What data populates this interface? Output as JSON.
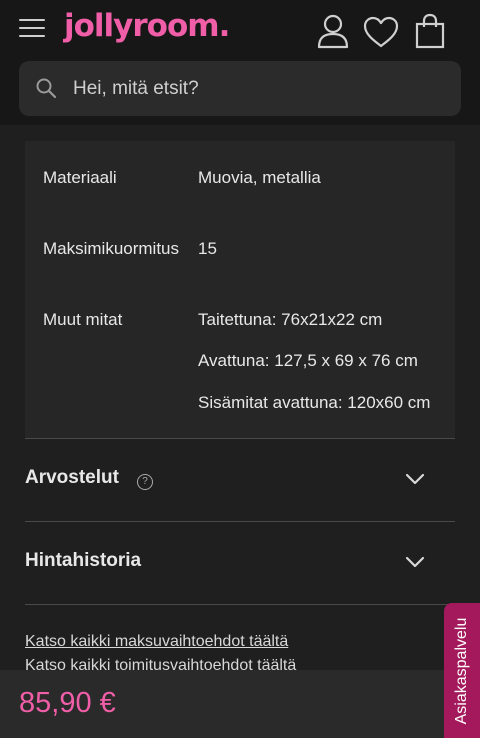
{
  "header": {
    "logo_text": "jollyroom.",
    "search_placeholder": "Hei, mitä etsit?",
    "icons": [
      "menu-icon",
      "user-icon",
      "heart-icon",
      "shopping-bag-icon",
      "search-icon"
    ]
  },
  "specs": [
    {
      "label": "Materiaali",
      "values": [
        "Muovia, metallia"
      ]
    },
    {
      "label": "Maksimikuormitus",
      "values": [
        "15"
      ]
    },
    {
      "label": "Muut mitat",
      "values": [
        "Taitettuna: 76x21x22 cm",
        "Avattuna: 127,5 x 69 x 76 cm",
        "Sisämitat avattuna: 120x60 cm"
      ]
    }
  ],
  "accordions": {
    "reviews": {
      "title": "Arvostelut",
      "help": "?"
    },
    "price_history": {
      "title": "Hintahistoria"
    }
  },
  "links": {
    "payment": "Katso kaikki maksuvaihtoehdot täältä",
    "delivery": "Katso kaikki toimitusvaihtoehdot täältä"
  },
  "price": "85,90 €",
  "customer_service": "Asiakaspalvelu",
  "colors": {
    "brand": "#f05ea8",
    "background": "#1f1f1f",
    "cs_tab": "#a3195b"
  }
}
